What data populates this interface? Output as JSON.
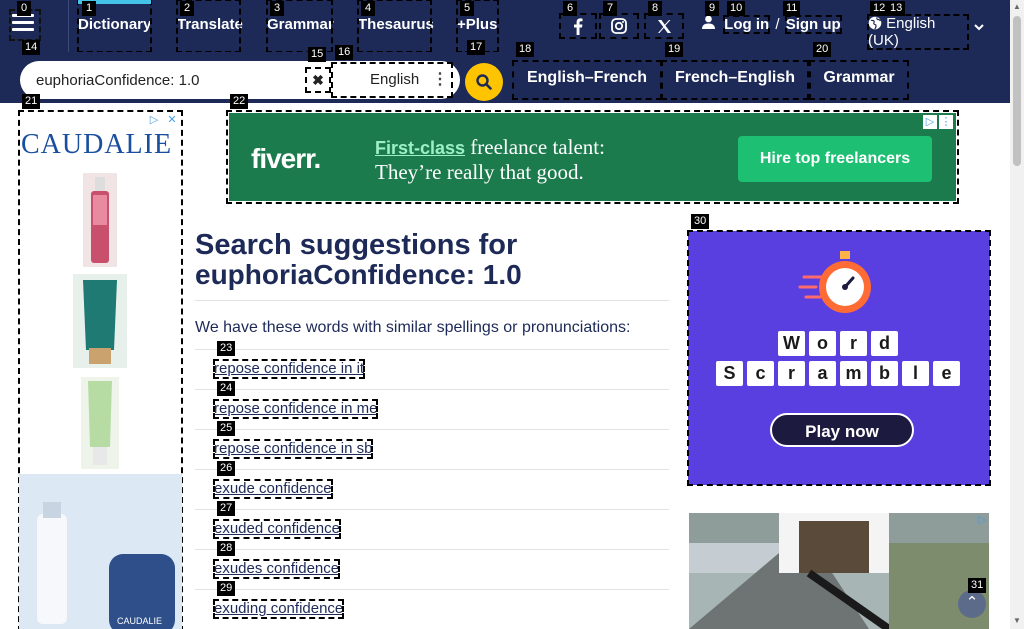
{
  "nav": {
    "links": [
      {
        "label": "Dictionary"
      },
      {
        "label": "Translate"
      },
      {
        "label": "Grammar"
      },
      {
        "label": "Thesaurus"
      },
      {
        "label": "+Plus"
      }
    ],
    "login": "Log in",
    "login_sep": "/",
    "signup": "Sign up",
    "language": "English (UK)"
  },
  "search": {
    "value": "euphoriaConfidence: 1.0",
    "dictionary": "English",
    "links": [
      "English–French",
      "French–English",
      "Grammar"
    ]
  },
  "ads": {
    "left_brand": "CAUDALIE",
    "fiverr_logo": "fiverr.",
    "fiverr_highlight": "First-class",
    "fiverr_line1_rest": " freelance talent:",
    "fiverr_line2": "They’re really that good.",
    "fiverr_button": "Hire top freelancers",
    "word_row1": [
      "W",
      "o",
      "r",
      "d"
    ],
    "word_row2": [
      "S",
      "c",
      "r",
      "a",
      "m",
      "b",
      "l",
      "e"
    ],
    "word_button": "Play now"
  },
  "main": {
    "heading_prefix": "Search suggestions for",
    "heading_query": "euphoriaConfidence: 1.0",
    "intro": "We have these words with similar spellings or pronunciations:",
    "suggestions": [
      "repose confidence in it",
      "repose confidence in me",
      "repose confidence in sb",
      "exude confidence",
      "exuded confidence",
      "exudes confidence",
      "exuding confidence"
    ]
  },
  "markers": [
    "0",
    "1",
    "2",
    "3",
    "4",
    "5",
    "6",
    "7",
    "8",
    "9",
    "10",
    "11",
    "12",
    "13",
    "14",
    "15",
    "16",
    "17",
    "18",
    "19",
    "20",
    "21",
    "22",
    "23",
    "24",
    "25",
    "26",
    "27",
    "28",
    "29",
    "30",
    "31"
  ],
  "colors": {
    "nav_bg": "#1d2a57",
    "accent_yellow": "#fec400",
    "fiverr_green": "#1dbf73",
    "word_purple": "#5a3fe0"
  }
}
